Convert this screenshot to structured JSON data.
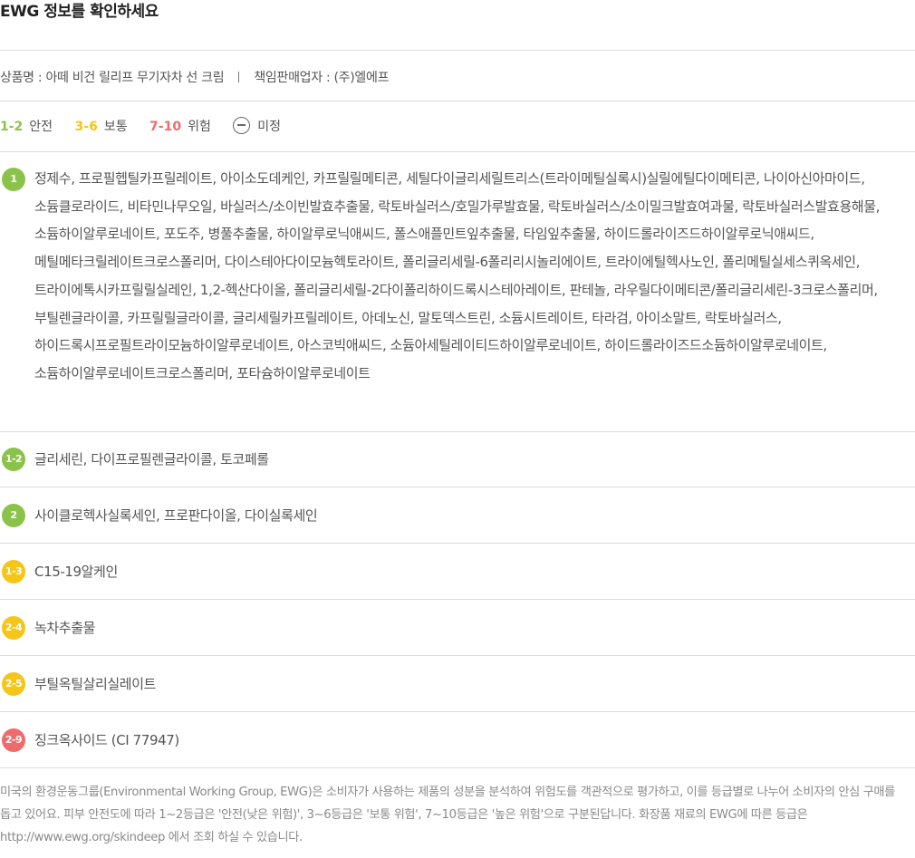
{
  "header": {
    "title": "EWG 정보를 확인하세요"
  },
  "product": {
    "name_label": "상품명 : 아떼 비건 릴리프 무기자차 선 크림",
    "seller_label": "책임판매업자 : (주)엘에프"
  },
  "legend": {
    "items": [
      {
        "range": "1-2",
        "label": "안전",
        "color": "#8bc34a"
      },
      {
        "range": "3-6",
        "label": "보통",
        "color": "#f5c518"
      },
      {
        "range": "7-10",
        "label": "위험",
        "color": "#ef6b6b"
      }
    ],
    "undetermined_label": "미정",
    "undetermined_icon": "minus-circle-icon"
  },
  "ingredients": [
    {
      "grade": "1",
      "color": "#8bc34a",
      "text": "정제수, 프로필헵틸카프릴레이트, 아이소도데케인, 카프릴릴메티콘, 세틸다이글리세릴트리스(트라이메틸실록시)실릴에틸다이메티콘, 나이아신아마이드, 소듐클로라이드, 비타민나무오일, 바실러스/소이빈발효추출물, 락토바실러스/호밀가루발효물, 락토바실러스/소이밀크발효여과물, 락토바실러스발효용해물, 소듐하이알루로네이트, 포도주, 병풀추출물, 하이알루로닉애씨드, 폴스애플민트잎추출물, 타임잎추출물, 하이드롤라이즈드하이알루로닉애씨드, 메틸메타크릴레이트크로스폴리머, 다이스테아다이모늄헥토라이트, 폴리글리세릴-6폴리리시놀리에이트, 트라이에틸헥사노인, 폴리메틸실세스퀴옥세인, 트라이에톡시카프릴릴실레인, 1,2-헥산다이올, 폴리글리세릴-2다이폴리하이드록시스테아레이트, 판테놀, 라우릴다이메티콘/폴리글리세린-3크로스폴리머, 부틸렌글라이콜, 카프릴릴글라이콜, 글리세릴카프릴레이트, 아데노신, 말토덱스트린, 소듐시트레이트, 타라검, 아이소말트, 락토바실러스, 하이드록시프로필트라이모늄하이알루로네이트, 아스코빅애씨드, 소듐아세틸레이티드하이알루로네이트, 하이드롤라이즈드소듐하이알루로네이트, 소듐하이알루로네이트크로스폴리머, 포타슘하이알루로네이트"
    },
    {
      "grade": "1-2",
      "color": "#8bc34a",
      "text": "글리세린, 다이프로필렌글라이콜, 토코페롤"
    },
    {
      "grade": "2",
      "color": "#8bc34a",
      "text": "사이클로헥사실록세인, 프로판다이올, 다이실록세인"
    },
    {
      "grade": "1-3",
      "color": "#f5c518",
      "text": "C15-19알케인"
    },
    {
      "grade": "2-4",
      "color": "#f5c518",
      "text": "녹차추출물"
    },
    {
      "grade": "2-5",
      "color": "#f5c518",
      "text": "부틸옥틸살리실레이트"
    },
    {
      "grade": "2-9",
      "color": "#ef6b6b",
      "text": "징크옥사이드 (CI 77947)"
    }
  ],
  "footnote": "미국의 환경운동그룹(Environmental Working Group, EWG)은 소비자가 사용하는 제품의 성분을 분석하여 위험도를 객관적으로 평가하고, 이를 등급별로 나누어 소비자의 안심 구매를 돕고 있어요. 피부 안전도에 따라 1~2등급은 '안전(낮은 위험)', 3~6등급은 '보통 위험', 7~10등급은 '높은 위험'으로 구분된답니다. 화장품 재료의 EWG에 따른 등급은 http://www.ewg.org/skindeep 에서 조회 하실 수 있습니다."
}
